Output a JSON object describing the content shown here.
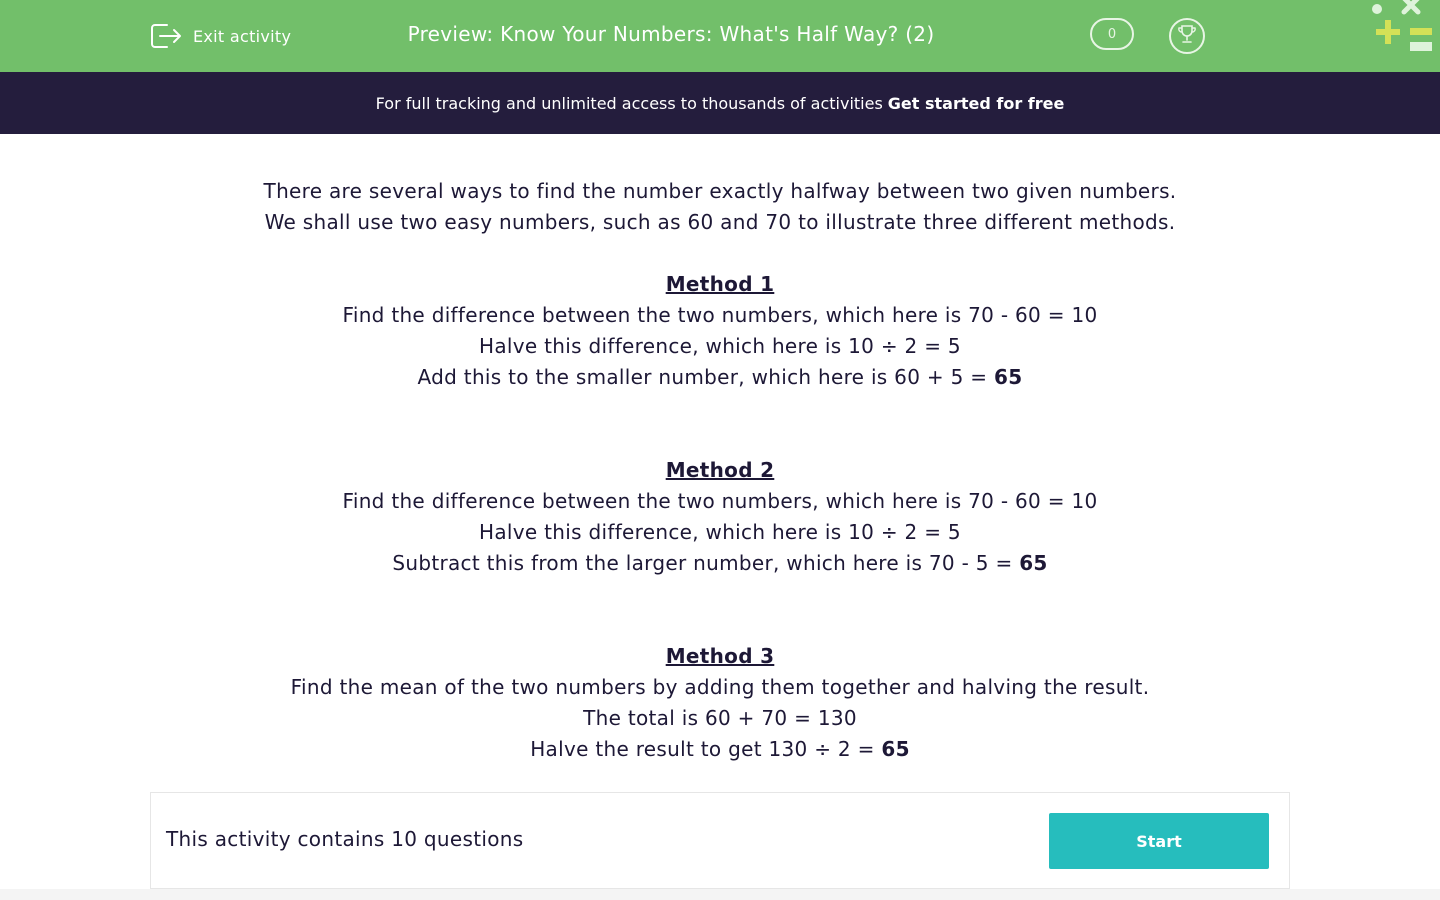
{
  "header": {
    "exit_label": "Exit activity",
    "title": "Preview: Know Your Numbers: What's Half Way? (2)",
    "score": "0",
    "bg_color": "#72bf6a",
    "icons": [
      "exit-icon",
      "trophy-icon",
      "logo-mark"
    ]
  },
  "promo": {
    "text": "For full tracking and unlimited access to thousands of activities",
    "cta": "Get started for free",
    "bg_color": "#241d3d"
  },
  "intro": [
    "There are several ways to find the number exactly halfway between two given numbers.",
    "We shall use two easy numbers, such as 60 and 70 to illustrate three different methods."
  ],
  "methods": [
    {
      "title": "Method 1",
      "lines": [
        "Find the difference between the two numbers, which here is 70 - 60 = 10",
        "Halve this difference, which here is 10 ÷ 2 = 5"
      ],
      "final_prefix": "Add this to the smaller number, which here is 60 + 5 =",
      "final_result": "65"
    },
    {
      "title": "Method 2",
      "lines": [
        "Find the difference between the two numbers, which here is 70 - 60 = 10",
        "Halve this difference, which here is 10 ÷ 2 = 5"
      ],
      "final_prefix": "Subtract this from the larger number, which here is 70 - 5 =",
      "final_result": "65"
    },
    {
      "title": "Method 3",
      "lines": [
        "Find the mean of the two numbers by adding them together and halving the result.",
        "The total is 60 + 70 = 130"
      ],
      "final_prefix": "Halve the result to get 130 ÷ 2 =",
      "final_result": "65"
    }
  ],
  "footer": {
    "question_count": "This activity contains 10 questions",
    "start_label": "Start",
    "start_color": "#26bdbd"
  }
}
